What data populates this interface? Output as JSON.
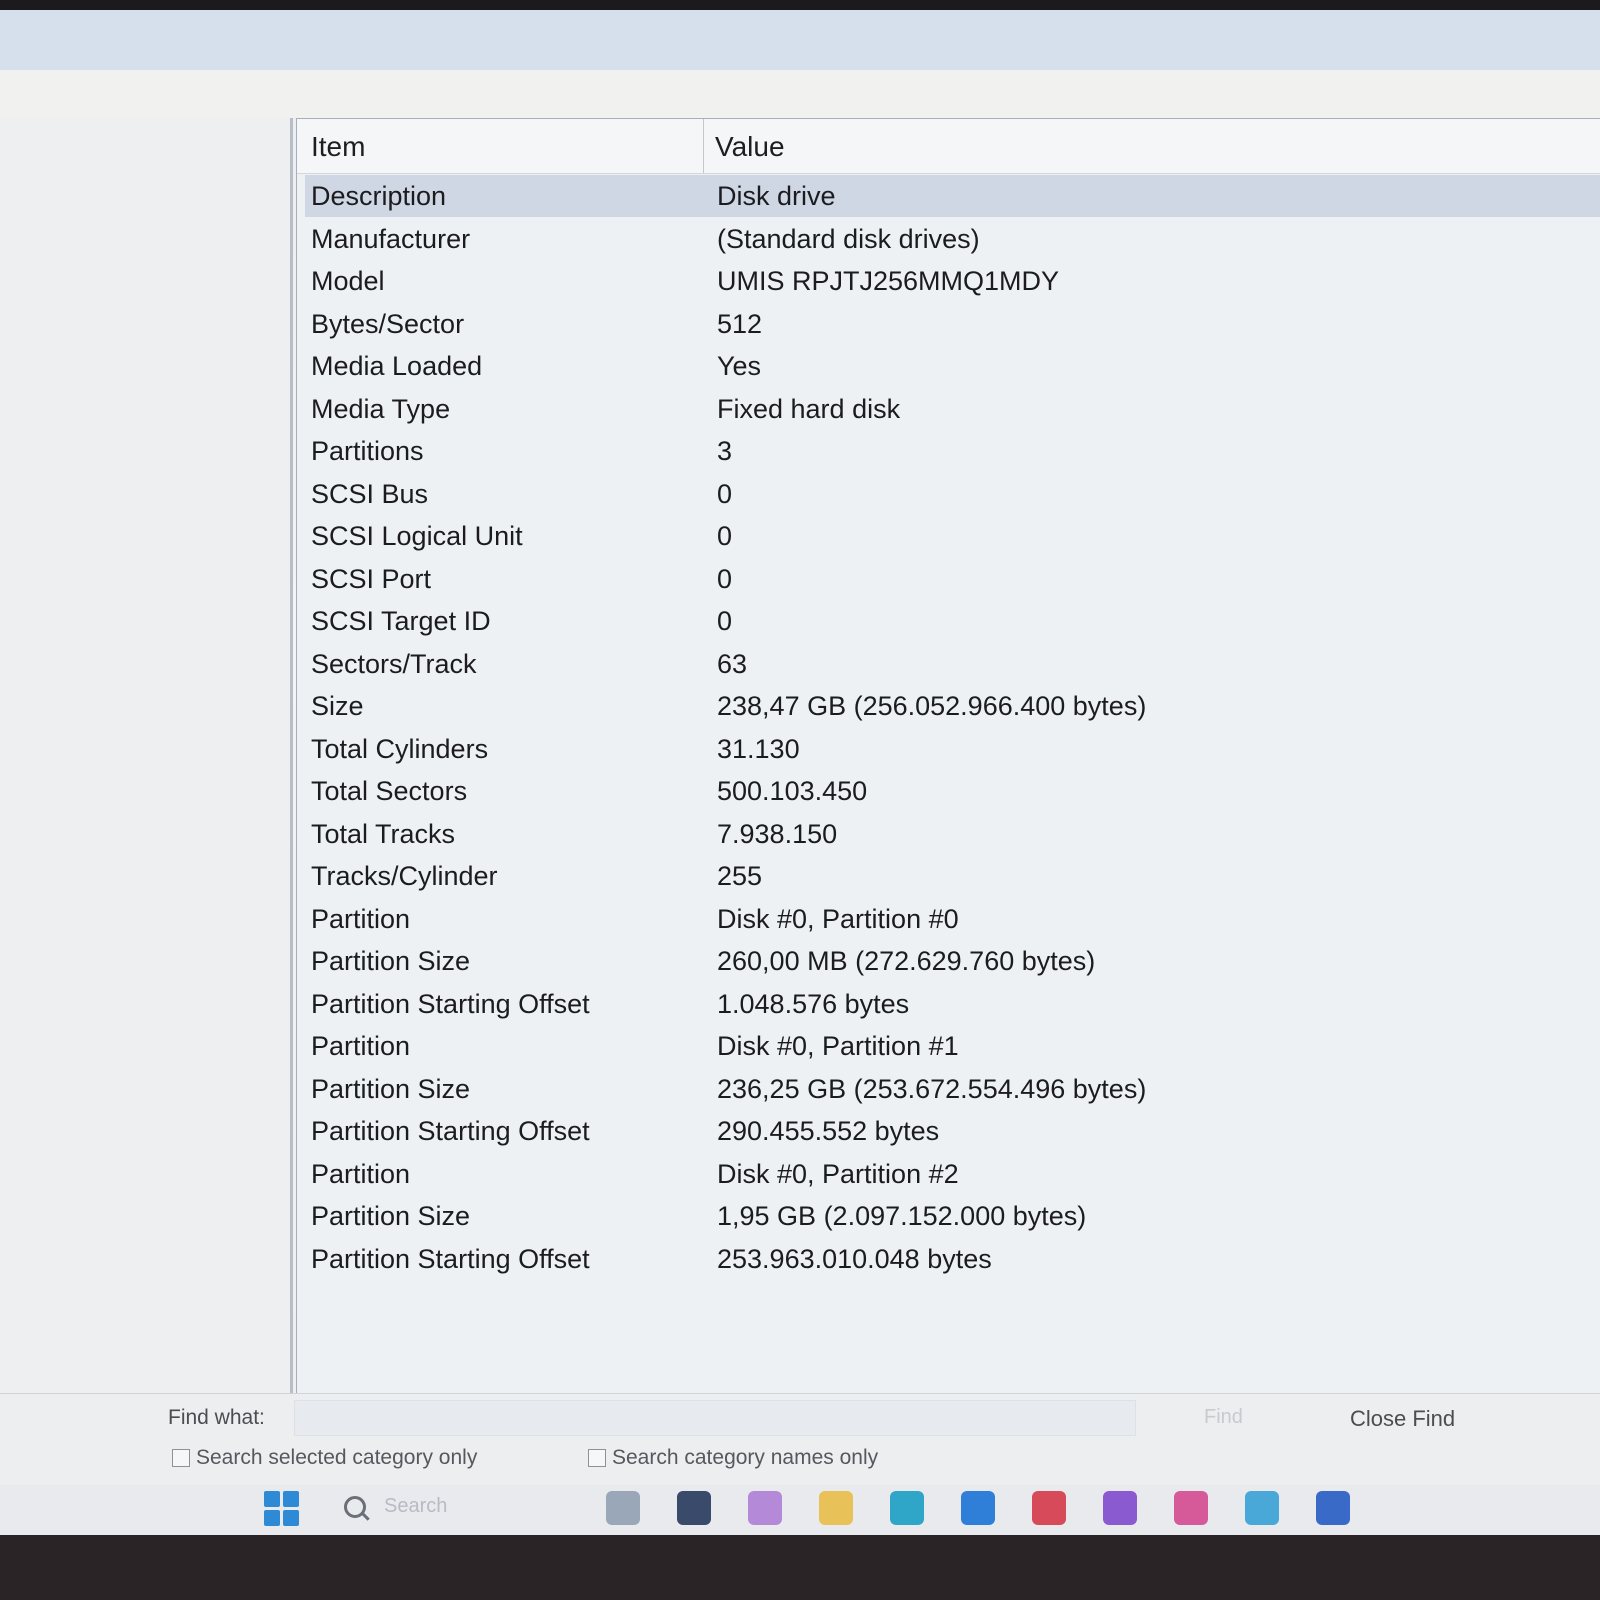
{
  "columns": {
    "item": "Item",
    "value": "Value"
  },
  "rows": [
    {
      "item": "Description",
      "value": "Disk drive"
    },
    {
      "item": "Manufacturer",
      "value": "(Standard disk drives)"
    },
    {
      "item": "Model",
      "value": "UMIS RPJTJ256MMQ1MDY"
    },
    {
      "item": "Bytes/Sector",
      "value": "512"
    },
    {
      "item": "Media Loaded",
      "value": "Yes"
    },
    {
      "item": "Media Type",
      "value": "Fixed hard disk"
    },
    {
      "item": "Partitions",
      "value": "3"
    },
    {
      "item": "SCSI Bus",
      "value": "0"
    },
    {
      "item": "SCSI Logical Unit",
      "value": "0"
    },
    {
      "item": "SCSI Port",
      "value": "0"
    },
    {
      "item": "SCSI Target ID",
      "value": "0"
    },
    {
      "item": "Sectors/Track",
      "value": "63"
    },
    {
      "item": "Size",
      "value": "238,47 GB (256.052.966.400 bytes)"
    },
    {
      "item": "Total Cylinders",
      "value": "31.130"
    },
    {
      "item": "Total Sectors",
      "value": "500.103.450"
    },
    {
      "item": "Total Tracks",
      "value": "7.938.150"
    },
    {
      "item": "Tracks/Cylinder",
      "value": "255"
    },
    {
      "item": "Partition",
      "value": "Disk #0, Partition #0"
    },
    {
      "item": "Partition Size",
      "value": "260,00 MB (272.629.760 bytes)"
    },
    {
      "item": "Partition Starting Offset",
      "value": "1.048.576 bytes"
    },
    {
      "item": "Partition",
      "value": "Disk #0, Partition #1"
    },
    {
      "item": "Partition Size",
      "value": "236,25 GB (253.672.554.496 bytes)"
    },
    {
      "item": "Partition Starting Offset",
      "value": "290.455.552 bytes"
    },
    {
      "item": "Partition",
      "value": "Disk #0, Partition #2"
    },
    {
      "item": "Partition Size",
      "value": "1,95 GB (2.097.152.000 bytes)"
    },
    {
      "item": "Partition Starting Offset",
      "value": "253.963.010.048 bytes"
    }
  ],
  "find": {
    "label": "Find what:",
    "find_button": "Find",
    "close_button": "Close Find",
    "check_selected_category": "Search selected category only",
    "check_category_names": "Search category names only"
  },
  "taskbar": {
    "search_placeholder": "Search",
    "icons": [
      {
        "name": "widgets-icon",
        "color": "#9aa7b8"
      },
      {
        "name": "app-l-icon",
        "color": "#3a4a6a"
      },
      {
        "name": "copilot-icon",
        "color": "#b48ad8"
      },
      {
        "name": "file-explorer-icon",
        "color": "#e8c258"
      },
      {
        "name": "edge-icon",
        "color": "#2fa6c8"
      },
      {
        "name": "store-icon",
        "color": "#2f7ed8"
      },
      {
        "name": "app-red-l-icon",
        "color": "#d64a5a"
      },
      {
        "name": "app-shield-icon",
        "color": "#8a5ad0"
      },
      {
        "name": "app-pink-circle-icon",
        "color": "#d65a9a"
      },
      {
        "name": "app-controller-icon",
        "color": "#4aa8d8"
      },
      {
        "name": "system-information-icon",
        "color": "#3a6ac8"
      }
    ]
  }
}
